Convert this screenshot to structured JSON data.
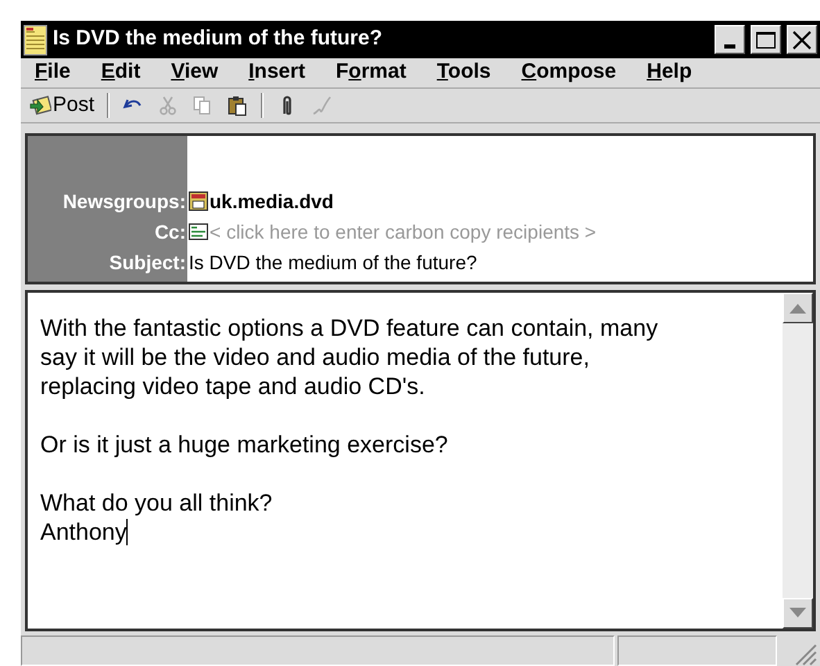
{
  "window": {
    "title": "Is DVD the medium of the future?"
  },
  "menu": [
    {
      "access_key": "F",
      "after_key": "ile"
    },
    {
      "access_key": "E",
      "after_key": "dit"
    },
    {
      "access_key": "V",
      "after_key": "iew"
    },
    {
      "access_key": "I",
      "after_key": "nsert"
    },
    {
      "before_key": "F",
      "access_key": "o",
      "after_key": "rmat"
    },
    {
      "access_key": "T",
      "after_key": "ools"
    },
    {
      "access_key": "C",
      "after_key": "ompose"
    },
    {
      "access_key": "H",
      "after_key": "elp"
    }
  ],
  "toolbar": [
    {
      "kind": "post",
      "label": "Post",
      "disabled": false
    },
    {
      "kind": "separator"
    },
    {
      "kind": "undo",
      "disabled": false
    },
    {
      "kind": "cut",
      "disabled": true
    },
    {
      "kind": "copy",
      "disabled": true
    },
    {
      "kind": "paste",
      "disabled": false
    },
    {
      "kind": "separator"
    },
    {
      "kind": "attach",
      "disabled": false
    },
    {
      "kind": "sign",
      "disabled": true
    }
  ],
  "header": [
    {
      "label": "Newsgroups:",
      "kind": "newsgroup",
      "value": "uk.media.dvd"
    },
    {
      "label": "Cc:",
      "kind": "cc",
      "placeholder": "< click here to enter carbon copy recipients >"
    },
    {
      "label": "Subject:",
      "kind": "subject",
      "value": "Is DVD the medium of the future?"
    }
  ],
  "body": {
    "paragraphs": [
      [
        "With the fantastic options a DVD feature can contain, many",
        "say it will be the video and audio media of the future,",
        "replacing video tape and audio CD's."
      ],
      [
        "Or is it just a huge marketing exercise?"
      ],
      [
        "What do you all think?",
        "Anthony"
      ]
    ]
  }
}
